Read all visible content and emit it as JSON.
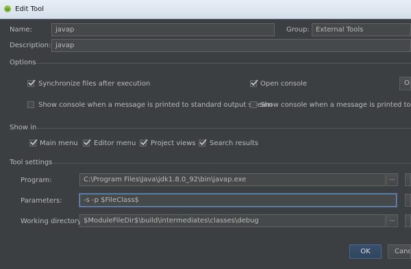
{
  "window": {
    "title": "Edit Tool"
  },
  "fields": {
    "name_label": "Name:",
    "name_value": "javap",
    "group_label": "Group:",
    "group_value": "External Tools",
    "description_label": "Description:",
    "description_value": "javap"
  },
  "options": {
    "section_label": "Options",
    "sync_label": "Synchronize files after execution",
    "open_console_label": "Open console",
    "show_stdout_label": "Show console when a message is printed to standard output stream",
    "show_stderr_label": "Show console when a message is printed to standa",
    "truncated_button": "O"
  },
  "show_in": {
    "section_label": "Show in",
    "main_menu": "Main menu",
    "editor_menu": "Editor menu",
    "project_views": "Project views",
    "search_results": "Search results"
  },
  "tool_settings": {
    "section_label": "Tool settings",
    "program_label": "Program:",
    "program_value": "C:\\Program Files\\Java\\jdk1.8.0_92\\bin\\javap.exe",
    "parameters_label": "Parameters:",
    "parameters_value": "-s -p $FileClass$",
    "workdir_label": "Working directory:",
    "workdir_value": "$ModuleFileDir$\\build\\intermediates\\classes\\debug",
    "browse_label": "..."
  },
  "buttons": {
    "ok": "OK",
    "cancel": "Cance"
  },
  "checks": {
    "sync": true,
    "open_console": true,
    "show_stdout": false,
    "show_stderr": false,
    "main_menu": true,
    "editor_menu": true,
    "project_views": true,
    "search_results": true
  }
}
